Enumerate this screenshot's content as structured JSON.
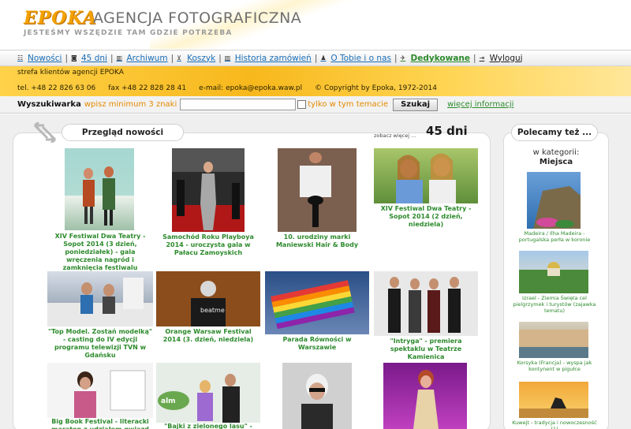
{
  "header": {
    "logo": "EPOKA",
    "agency": "AGENCJA FOTOGRAFICZNA",
    "tagline": "JESTEŚMY WSZĘDZIE TAM GDZIE POTRZEBA"
  },
  "nav": {
    "items": [
      {
        "label": "Nowości",
        "icon": "news-icon"
      },
      {
        "label": "45 dni",
        "icon": "camera-icon"
      },
      {
        "label": "Archiwum",
        "icon": "book-icon"
      },
      {
        "label": "Koszyk",
        "icon": "cart-icon"
      },
      {
        "label": "Historia zamówień",
        "icon": "book-icon"
      },
      {
        "label": "O Tobie i o nas",
        "icon": "user-icon"
      },
      {
        "label": "Dedykowane",
        "icon": "runner-icon"
      },
      {
        "label": "Wyloguj",
        "icon": "logout-icon"
      }
    ]
  },
  "band": {
    "title": "strefa klientów agencji EPOKA",
    "tel": "tel. +48 22 826 63 06",
    "fax": "fax +48 22 828 28 41",
    "email": "e-mail: epoka@epoka.waw.pl",
    "copyright": "© Copyright by Epoka, 1972-2014"
  },
  "search": {
    "label": "Wyszukiwarka",
    "hint": "wpisz minimum 3 znaki",
    "value": "",
    "checkbox_label": "tylko w tym temacie",
    "button": "Szukaj",
    "more": "więcej informacji"
  },
  "main": {
    "title": "Przegląd nowości",
    "see_more": "zobacz więcej ...",
    "badge": "45 dni",
    "news": [
      {
        "caption": "XIV Festiwal Dwa Teatry - Sopot 2014 (3 dzień, poniedziałek) - gala wręczenia nagród i zamknięcia festiwalu"
      },
      {
        "caption": "Samochód Roku Playboya 2014 - uroczysta gala w Pałacu Zamoyskich"
      },
      {
        "caption": "10. urodziny marki Maniewski Hair & Body"
      },
      {
        "caption": "XIV Festiwal Dwa Teatry - Sopot 2014 (2 dzień, niedziela)"
      },
      {
        "caption": "\"Top Model. Zostań modelką\" - casting do IV edycji programu telewizji TVN w Gdańsku"
      },
      {
        "caption": "Orange Warsaw Festival 2014 (3. dzień, niedziela)"
      },
      {
        "caption": "Parada Równości w Warszawie"
      },
      {
        "caption": "\"Intryga\" - premiera spektaklu w Teatrze Kamienica"
      },
      {
        "caption": "Big Book Festival - literacki maraton z udziałem gwiazd"
      },
      {
        "caption": "\"Bajki z zielonego lasu\" -"
      },
      {
        "caption": ""
      },
      {
        "caption": ""
      }
    ]
  },
  "sidebar": {
    "title": "Polecamy też ...",
    "category_label": "w kategorii:",
    "category": "Miejsca",
    "items": [
      {
        "caption": "Madeira / Ilha Madeira - portugalska perła w koronie"
      },
      {
        "caption": "Izrael - Ziemia Święta cel pielgrzymek i turystów (zajawka tematu)"
      },
      {
        "caption": "Korsyka (Francja) - wyspa jak kontynent w pigułce"
      },
      {
        "caption": "Kuwejt - tradycja i nowoczesność (1)"
      }
    ]
  }
}
